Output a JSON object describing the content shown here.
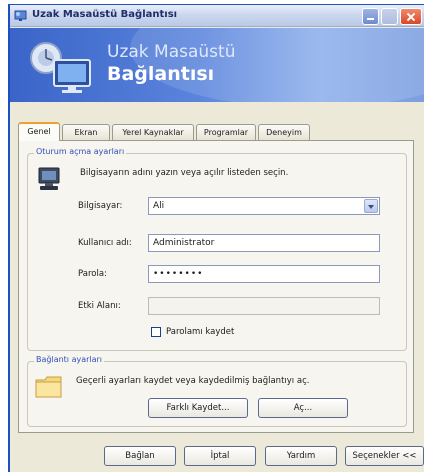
{
  "window": {
    "title": "Uzak Masaüstü Bağlantısı",
    "banner_line1": "Uzak Masaüstü",
    "banner_line2": "Bağlantısı",
    "accent": "#3a64c8"
  },
  "tabs": [
    {
      "label": "Genel",
      "active": true
    },
    {
      "label": "Ekran"
    },
    {
      "label": "Yerel Kaynaklar"
    },
    {
      "label": "Programlar"
    },
    {
      "label": "Deneyim"
    }
  ],
  "logon": {
    "group_title": "Oturum açma ayarları",
    "description": "Bilgisayarın adını yazın veya açılır listeden seçin.",
    "computer_label": "Bilgisayar:",
    "computer_value": "Ali",
    "username_label": "Kullanıcı adı:",
    "username_value": "Administrator",
    "password_label": "Parola:",
    "password_value": "••••••••",
    "domain_label": "Etki Alanı:",
    "domain_value": "",
    "save_password_label": "Parolamı kaydet",
    "save_password_checked": false
  },
  "connection": {
    "group_title": "Bağlantı ayarları",
    "description": "Geçerli ayarları kaydet veya kaydedilmiş bağlantıyı aç.",
    "save_as_label": "Farklı Kaydet...",
    "open_label": "Aç..."
  },
  "footer": {
    "connect_label": "Bağlan",
    "cancel_label": "İptal",
    "help_label": "Yardım",
    "options_label": "Seçenekler <<"
  }
}
